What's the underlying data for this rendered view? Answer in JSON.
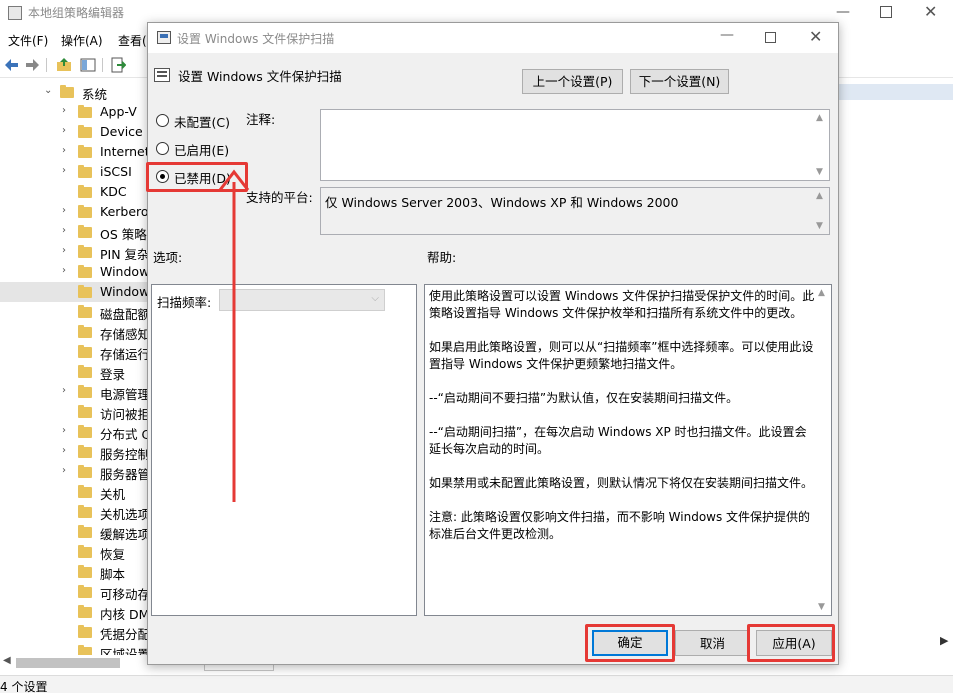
{
  "background_window": {
    "title": "本地组策略编辑器",
    "menu": [
      "文件(F)",
      "操作(A)",
      "查看("
    ],
    "tree_items": [
      {
        "label": "系统",
        "expanded": true
      },
      {
        "label": "App-V"
      },
      {
        "label": "Device C"
      },
      {
        "label": "Internet"
      },
      {
        "label": "iSCSI"
      },
      {
        "label": "KDC"
      },
      {
        "label": "Kerbero"
      },
      {
        "label": "OS 策略"
      },
      {
        "label": "PIN 复杂"
      },
      {
        "label": "Window"
      },
      {
        "label": "Window",
        "selected": true
      },
      {
        "label": "磁盘配额"
      },
      {
        "label": "存储感知"
      },
      {
        "label": "存储运行"
      },
      {
        "label": "登录"
      },
      {
        "label": "电源管理"
      },
      {
        "label": "访问被拒"
      },
      {
        "label": "分布式 C"
      },
      {
        "label": "服务控制"
      },
      {
        "label": "服务器管"
      },
      {
        "label": "关机"
      },
      {
        "label": "关机选项"
      },
      {
        "label": "缓解选项"
      },
      {
        "label": "恢复"
      },
      {
        "label": "脚本"
      },
      {
        "label": "可移动存"
      },
      {
        "label": "内核 DM"
      },
      {
        "label": "凭据分配"
      },
      {
        "label": "区域设置"
      }
    ],
    "status": "4 个设置"
  },
  "dialog": {
    "title": "设置 Windows 文件保护扫描",
    "heading": "设置 Windows 文件保护扫描",
    "prev_button": "上一个设置(P)",
    "next_button": "下一个设置(N)",
    "radio_options": [
      {
        "label": "未配置(C)",
        "checked": false
      },
      {
        "label": "已启用(E)",
        "checked": false
      },
      {
        "label": "已禁用(D)",
        "checked": true
      }
    ],
    "comment_label": "注释:",
    "comment_value": "",
    "platform_label": "支持的平台:",
    "platform_value": "仅 Windows Server 2003、Windows XP 和 Windows 2000",
    "options_label": "选项:",
    "help_label": "帮助:",
    "frequency_label": "扫描频率:",
    "frequency_value": "",
    "help_paragraphs": [
      "使用此策略设置可以设置 Windows 文件保护扫描受保护文件的时间。此策略设置指导 Windows 文件保护枚举和扫描所有系统文件中的更改。",
      "如果启用此策略设置，则可以从“扫描频率”框中选择频率。可以使用此设置指导 Windows 文件保护更频繁地扫描文件。",
      "--“启动期间不要扫描”为默认值，仅在安装期间扫描文件。",
      "--“启动期间扫描”，在每次启动 Windows XP 时也扫描文件。此设置会延长每次启动的时间。",
      "如果禁用或未配置此策略设置，则默认情况下将仅在安装期间扫描文件。",
      "注意: 此策略设置仅影响文件扫描，而不影响 Windows 文件保护提供的标准后台文件更改检测。"
    ],
    "ok_button": "确定",
    "cancel_button": "取消",
    "apply_button": "应用(A)"
  },
  "colors": {
    "annotation_red": "#e53935",
    "focus_blue": "#0078d7",
    "folder_yellow": "#e8c25a"
  }
}
